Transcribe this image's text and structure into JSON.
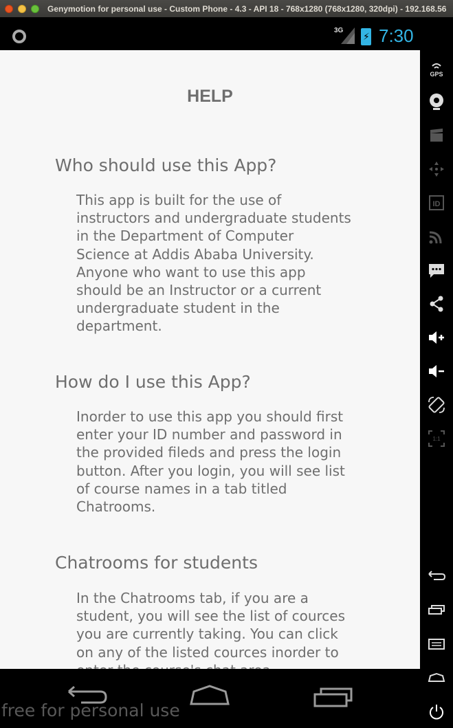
{
  "window": {
    "title": "Genymotion for personal use - Custom Phone - 4.3 - API 18 - 768x1280 (768x1280, 320dpi) - 192.168.56"
  },
  "statusbar": {
    "network": "3G",
    "time": "7:30"
  },
  "page": {
    "title": "HELP",
    "sections": [
      {
        "heading": "Who should use this App?",
        "body": "This app is built for the use of instructors and undergraduate students in the Department of Computer Science at Addis Ababa University. Anyone who want to use this app should be an Instructor or a current undergraduate student in the department."
      },
      {
        "heading": "How do I use this App?",
        "body": "Inorder to use this app you should first enter your ID number and password in the provided fileds and press the login button. After you login, you will see list of course names in a tab titled Chatrooms."
      },
      {
        "heading": "Chatrooms for students",
        "body": "In the Chatrooms tab, if you are a student, you will see the list of cources you are currently taking. You can click on any of the listed cources inorder to enter the course's chat area."
      }
    ]
  },
  "navbar": {
    "watermark": "free for personal use"
  },
  "sidebar": {
    "gps_label": "GPS",
    "pixel_label": "1:1"
  }
}
